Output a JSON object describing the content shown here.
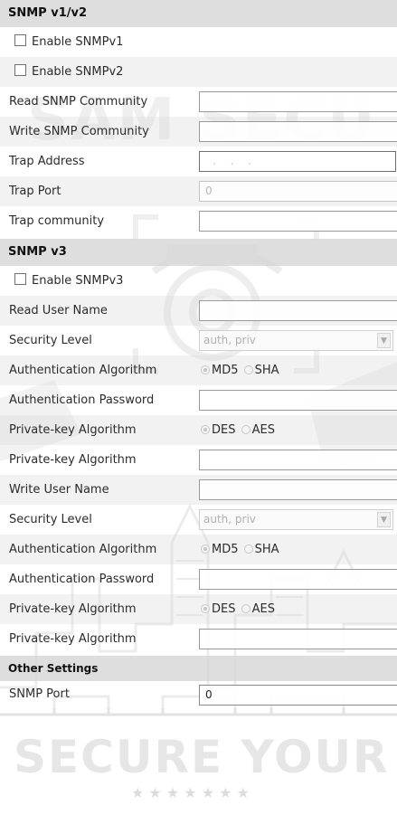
{
  "snmp_v12": {
    "header": "SNMP v1/v2",
    "enable_v1": {
      "label": "Enable SNMPv1",
      "checked": false
    },
    "enable_v2": {
      "label": "Enable SNMPv2",
      "checked": false
    },
    "read_community": {
      "label": "Read SNMP Community",
      "value": ""
    },
    "write_community": {
      "label": "Write SNMP Community",
      "value": ""
    },
    "trap_address": {
      "label": "Trap Address",
      "value": ". . ."
    },
    "trap_port": {
      "label": "Trap Port",
      "value": "0"
    },
    "trap_community": {
      "label": "Trap community",
      "value": ""
    }
  },
  "snmp_v3": {
    "header": "SNMP v3",
    "enable_v3": {
      "label": "Enable SNMPv3",
      "checked": false
    },
    "read_user_name": {
      "label": "Read User Name",
      "value": ""
    },
    "read_security_level": {
      "label": "Security Level",
      "value": "auth, priv"
    },
    "read_auth_algorithm": {
      "label": "Authentication Algorithm",
      "options": [
        "MD5",
        "SHA"
      ],
      "selected": "MD5"
    },
    "read_auth_password": {
      "label": "Authentication Password",
      "value": ""
    },
    "read_private_algorithm": {
      "label": "Private-key Algorithm",
      "options": [
        "DES",
        "AES"
      ],
      "selected": "DES"
    },
    "read_private_password": {
      "label": "Private-key Algorithm",
      "value": ""
    },
    "write_user_name": {
      "label": "Write User Name",
      "value": ""
    },
    "write_security_level": {
      "label": "Security Level",
      "value": "auth, priv"
    },
    "write_auth_algorithm": {
      "label": "Authentication Algorithm",
      "options": [
        "MD5",
        "SHA"
      ],
      "selected": "MD5"
    },
    "write_auth_password": {
      "label": "Authentication Password",
      "value": ""
    },
    "write_private_algorithm": {
      "label": "Private-key Algorithm",
      "options": [
        "DES",
        "AES"
      ],
      "selected": "DES"
    },
    "write_private_password": {
      "label": "Private-key Algorithm",
      "value": ""
    }
  },
  "other_settings": {
    "header": "Other Settings",
    "snmp_port": {
      "label": "SNMP Port",
      "value": "0"
    }
  },
  "watermark": {
    "top_text": "SAM SECU",
    "bottom_text": "SECURE YOUR"
  },
  "colors": {
    "section_header_bg": "#d8d8d8",
    "alt_row_bg": "#e8e8e8",
    "watermark": "#e6e6e6"
  }
}
